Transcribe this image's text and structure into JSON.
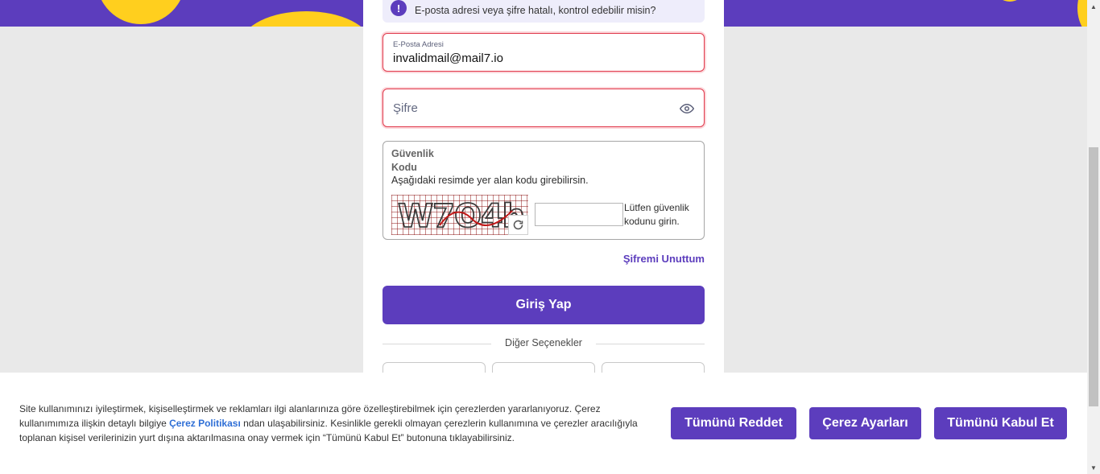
{
  "alert": {
    "icon": "exclamation-icon",
    "glyph": "!",
    "message": "E-posta adresi veya şifre hatalı, kontrol edebilir misin?"
  },
  "email": {
    "label": "E-Posta Adresi",
    "value": "invalidmail@mail7.io"
  },
  "password": {
    "placeholder": "Şifre",
    "toggle_icon": "eye-icon"
  },
  "captcha": {
    "title": "Güvenlik Kodu",
    "description": "Aşağıdaki resimde yer alan kodu girebilirsin.",
    "image_text": "W7O4h",
    "refresh_icon": "refresh-icon",
    "input_value": "",
    "hint": "Lütfen güvenlik kodunu girin."
  },
  "forgot_password": "Şifremi Unuttum",
  "login_button": "Giriş Yap",
  "other_options": "Diğer Seçenekler",
  "cookie": {
    "text_before": "Site kullanımınızı iyileştirmek, kişiselleştirmek ve reklamları ilgi alanlarınıza göre özelleştirebilmek için çerezlerden yararlanıyoruz. Çerez kullanımımıza ilişkin detaylı bilgiye ",
    "link": "Çerez Politikası",
    "text_after": " ndan ulaşabilirsiniz. Kesinlikle gerekli olmayan çerezlerin kullanımına ve çerezler aracılığıyla toplanan kişisel verilerinizin yurt dışına aktarılmasına onay vermek için “Tümünü Kabul Et” butonuna tıklayabilirsiniz.",
    "reject_all": "Tümünü Reddet",
    "settings": "Çerez Ayarları",
    "accept_all": "Tümünü Kabul Et"
  },
  "colors": {
    "brand": "#5c3dbd",
    "accent_yellow": "#ffcf1e",
    "error": "#e0394b",
    "link": "#2f6fd6"
  }
}
